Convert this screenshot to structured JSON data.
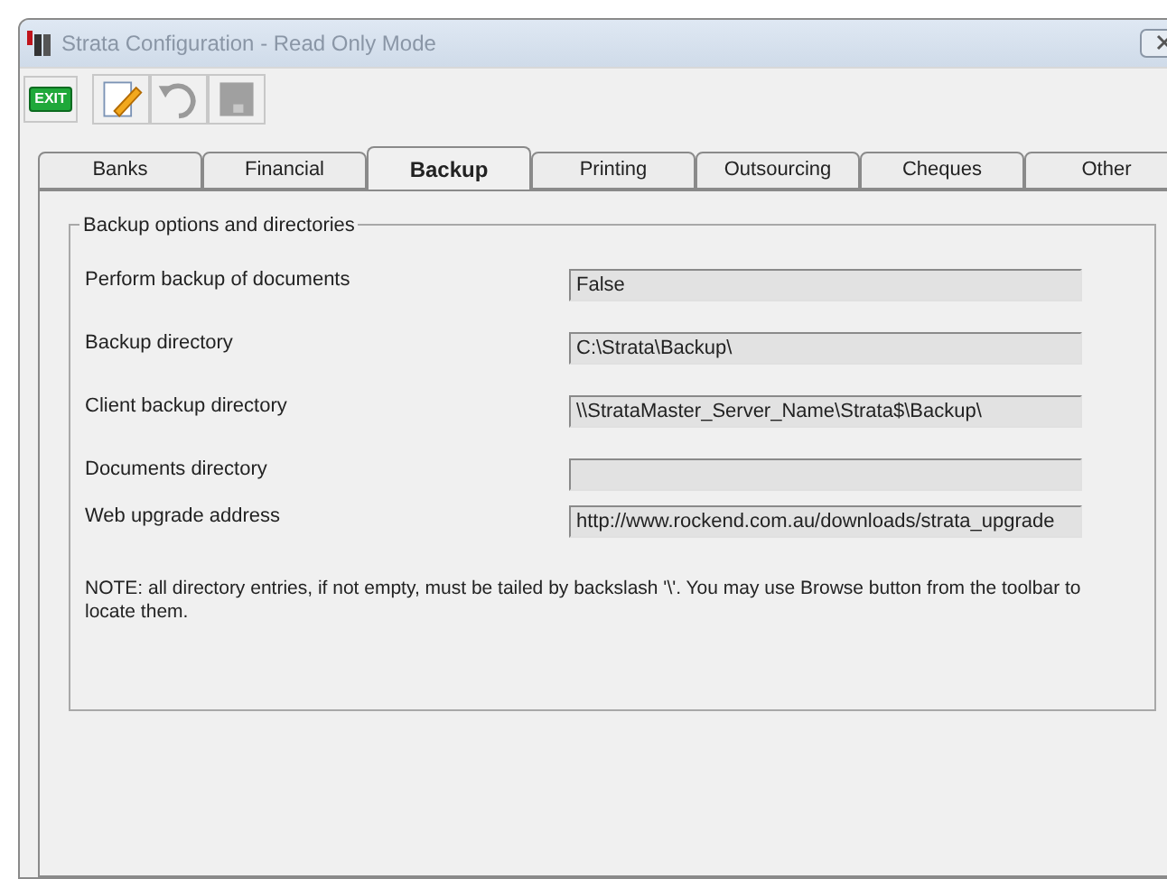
{
  "window": {
    "title": "Strata Configuration - Read Only Mode"
  },
  "toolbar": {
    "exit_label": "EXIT"
  },
  "tabs": [
    {
      "label": "Banks",
      "selected": false
    },
    {
      "label": "Financial",
      "selected": false
    },
    {
      "label": "Backup",
      "selected": true
    },
    {
      "label": "Printing",
      "selected": false
    },
    {
      "label": "Outsourcing",
      "selected": false
    },
    {
      "label": "Cheques",
      "selected": false
    },
    {
      "label": "Other",
      "selected": false
    }
  ],
  "group": {
    "title": "Backup options and directories",
    "fields": [
      {
        "label": "Perform backup of documents",
        "value": "False"
      },
      {
        "label": "Backup directory",
        "value": "C:\\Strata\\Backup\\"
      },
      {
        "label": "Client backup directory",
        "value": "\\\\StrataMaster_Server_Name\\Strata$\\Backup\\"
      },
      {
        "label": "Documents directory"
      },
      {
        "label": "Web upgrade address",
        "value": "http://www.rockend.com.au/downloads/strata_upgrade"
      }
    ],
    "note": "NOTE: all directory entries, if not empty, must be tailed by backslash '\\'. You may use Browse button from the toolbar to locate them."
  }
}
